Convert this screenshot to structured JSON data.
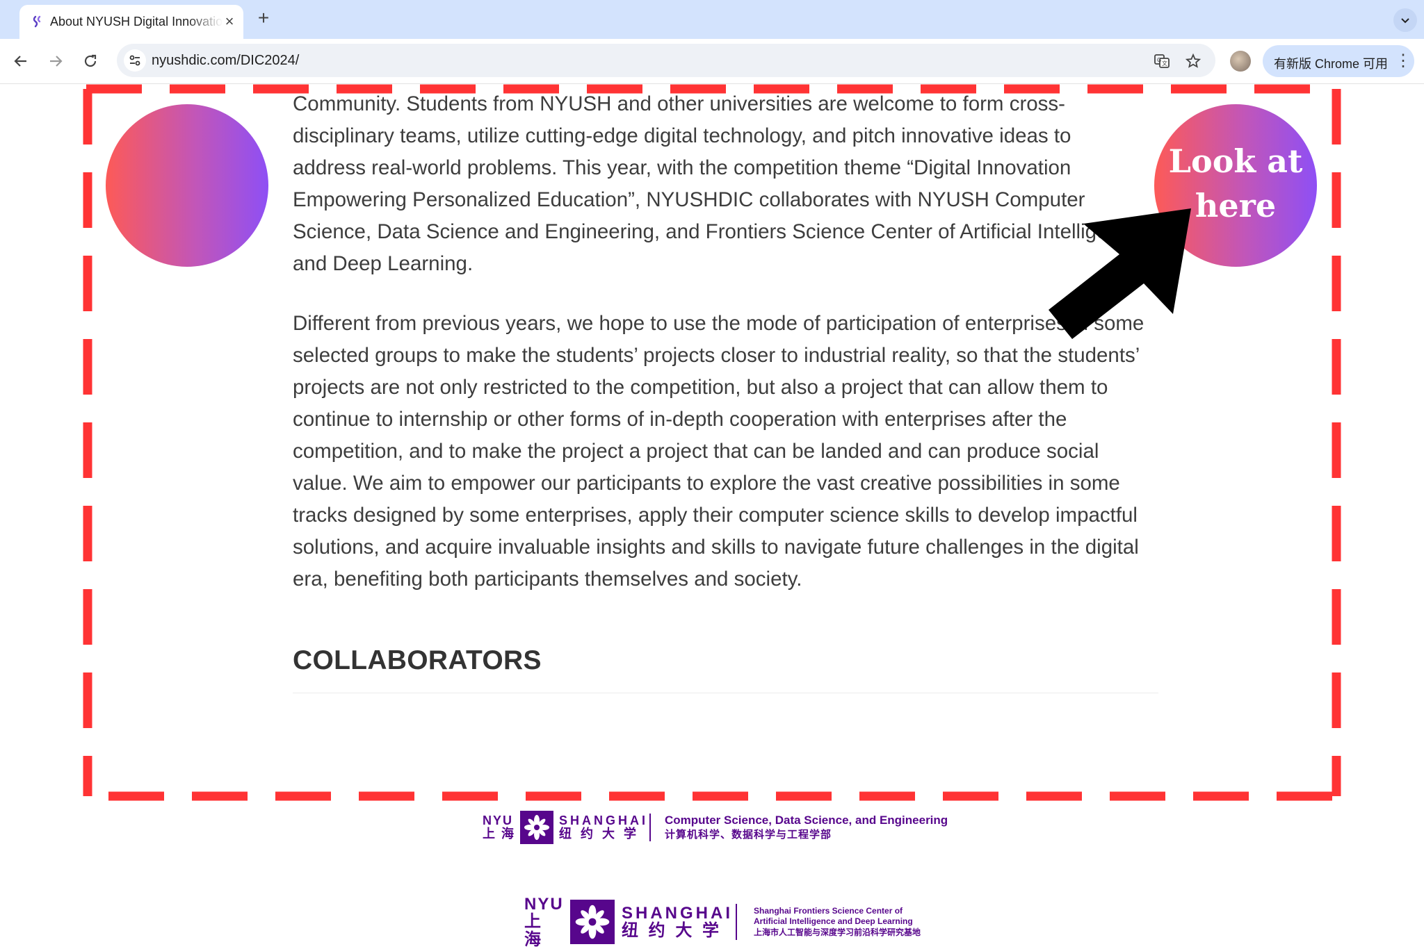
{
  "browser": {
    "tab_title": "About NYUSH Digital Innovation Competition",
    "url": "nyushdic.com/DIC2024/",
    "update_chip_label": "有新版 Chrome 可用",
    "icons": {
      "favicon": "link-favicon-icon",
      "close": "close-icon",
      "new_tab": "plus-icon",
      "tab_search": "chevron-down-icon",
      "back": "back-arrow-icon",
      "forward": "forward-arrow-icon",
      "reload": "reload-icon",
      "site_info": "tune-icon",
      "translate": "translate-icon",
      "bookmark": "star-icon",
      "menu": "kebab-menu-icon"
    }
  },
  "content": {
    "paragraph_1": "Community. Students from NYUSH and other universities are welcome to form cross-\ndisciplinary teams, utilize cutting-edge digital technology, and pitch innovative ideas to\naddress real-world problems. This year, with the competition theme “Digital Innovation\nEmpowering Personalized Education”, NYUSHDIC collaborates with NYUSH Computer\nScience, Data Science and Engineering, and Frontiers Science Center of Artificial Intelligence\nand Deep Learning.",
    "paragraph_2": "Different from previous years, we hope to use the mode of participation of enterprises in some\nselected groups to make the students’ projects closer to industrial reality, so that the students’\nprojects are not only restricted to the competition, but also a project that can allow them to\ncontinue to internship or other forms of in-depth cooperation with enterprises after the\ncompetition, and to make the project a project that can be landed and can produce social\nvalue. We aim to empower our participants to explore the vast creative possibilities in some\ntracks designed by some enterprises, apply their computer science skills to develop impactful\nsolutions, and acquire invaluable insights and skills to navigate future challenges in the digital\nera, benefiting both participants themselves and society.",
    "collaborators_heading": "COLLABORATORS"
  },
  "logos": [
    {
      "nyu_en": "NYU",
      "nyu_zh": "上 海",
      "shanghai_en": "SHANGHAI",
      "shanghai_zh": "纽 约 大 学",
      "desc_en": "Computer Science, Data Science, and Engineering",
      "desc_zh": "计算机科学、数据科学与工程学部"
    },
    {
      "nyu_en": "NYU",
      "nyu_zh": "上 海",
      "shanghai_en": "SHANGHAI",
      "shanghai_zh": "纽 约 大 学",
      "desc_line1": "Shanghai Frontiers Science Center of",
      "desc_line2": "Artificial Intelligence and Deep Learning",
      "desc_zh": "上海市人工智能与深度学习前沿科学研究基地"
    }
  ],
  "annotation": {
    "callout_line1": "Look at",
    "callout_line2": "here",
    "frame_color": "#ff3334",
    "circle_gradient": [
      "#fd5a57",
      "#c256b8",
      "#8e4ff5"
    ],
    "arrow_icon": "arrow-pointer-icon"
  },
  "colors": {
    "tab_strip": "#d3e3fd",
    "brand_purple": "#57068c",
    "body_text": "#3d3d3d"
  }
}
